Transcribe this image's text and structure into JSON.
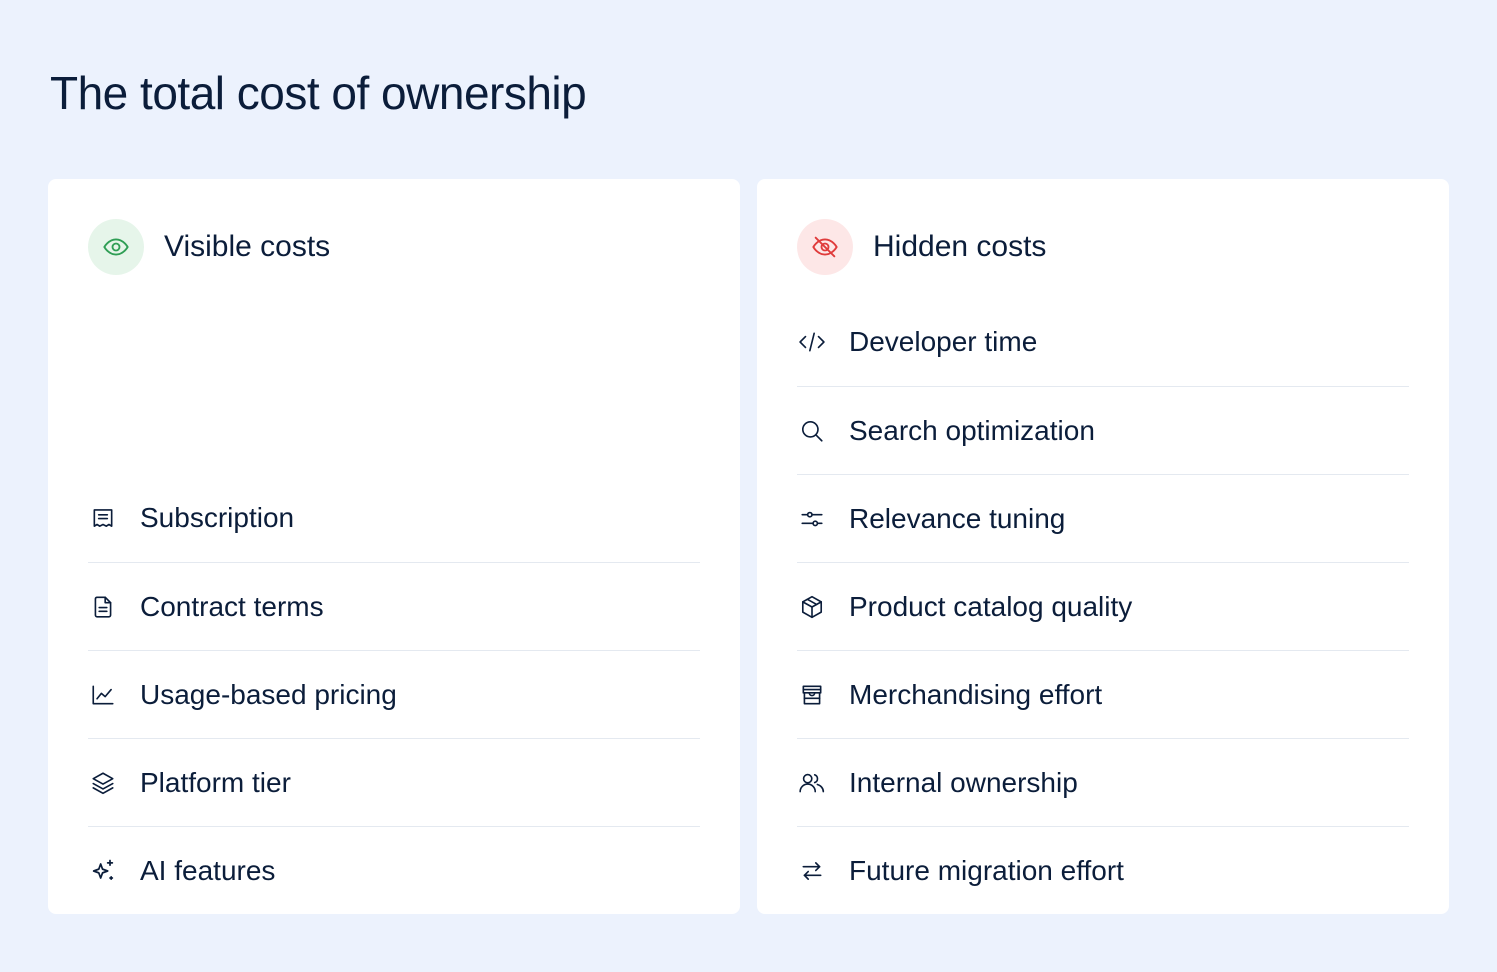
{
  "page": {
    "title": "The total cost of ownership"
  },
  "visible": {
    "title": "Visible costs",
    "header_icon": "eye-icon",
    "header_icon_color": "#2f9e55",
    "header_badge_color": "#e6f5ea",
    "items": [
      {
        "label": "Subscription",
        "icon": "receipt-icon"
      },
      {
        "label": "Contract terms",
        "icon": "document-icon"
      },
      {
        "label": "Usage-based pricing",
        "icon": "trend-chart-icon"
      },
      {
        "label": "Platform tier",
        "icon": "layers-icon"
      },
      {
        "label": "AI features",
        "icon": "sparkles-icon"
      }
    ]
  },
  "hidden": {
    "title": "Hidden costs",
    "header_icon": "eye-off-icon",
    "header_icon_color": "#e03b3b",
    "header_badge_color": "#fde7e7",
    "items": [
      {
        "label": "Developer time",
        "icon": "code-icon"
      },
      {
        "label": "Search optimization",
        "icon": "search-icon"
      },
      {
        "label": "Relevance tuning",
        "icon": "sliders-icon"
      },
      {
        "label": "Product catalog quality",
        "icon": "box-icon"
      },
      {
        "label": "Merchandising effort",
        "icon": "storefront-icon"
      },
      {
        "label": "Internal ownership",
        "icon": "users-icon"
      },
      {
        "label": "Future migration effort",
        "icon": "swap-arrows-icon"
      }
    ]
  },
  "colors": {
    "background": "#ecf2fd",
    "card": "#ffffff",
    "text": "#0b1d3a",
    "divider": "#e4e9f0"
  }
}
